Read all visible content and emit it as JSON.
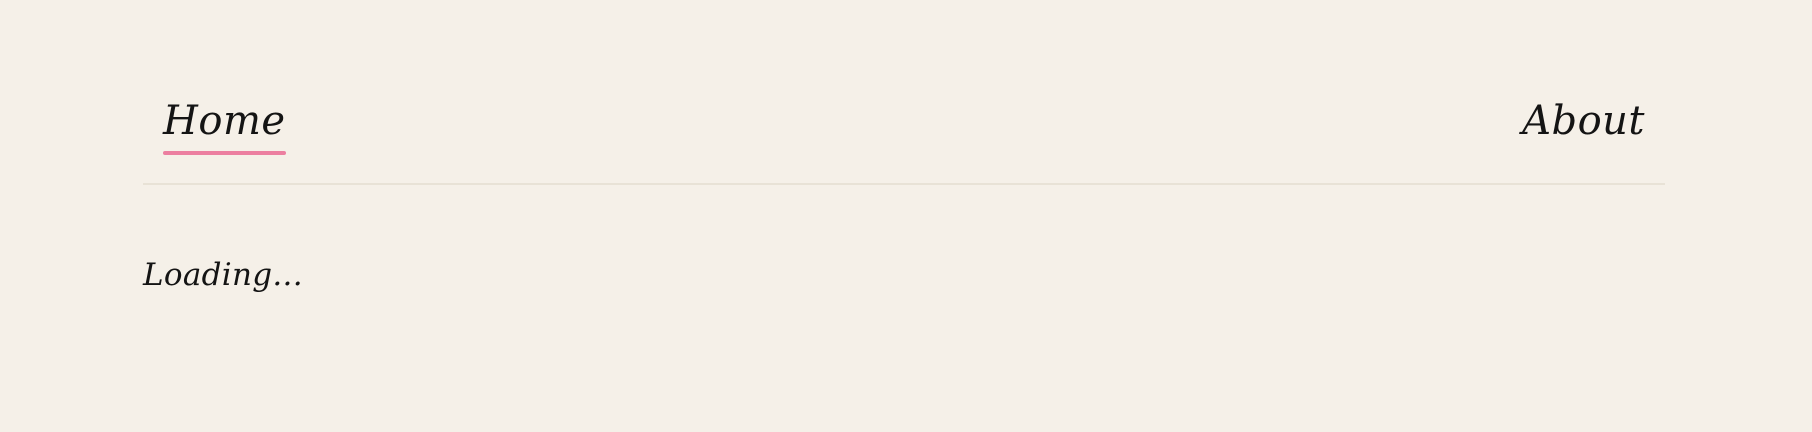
{
  "nav": {
    "home_label": "Home",
    "about_label": "About",
    "active_accent": "#ec7fa0"
  },
  "main": {
    "status_text": "Loading..."
  },
  "colors": {
    "background": "#f5f0e8",
    "text": "#141414",
    "divider": "#e8e2d6"
  }
}
